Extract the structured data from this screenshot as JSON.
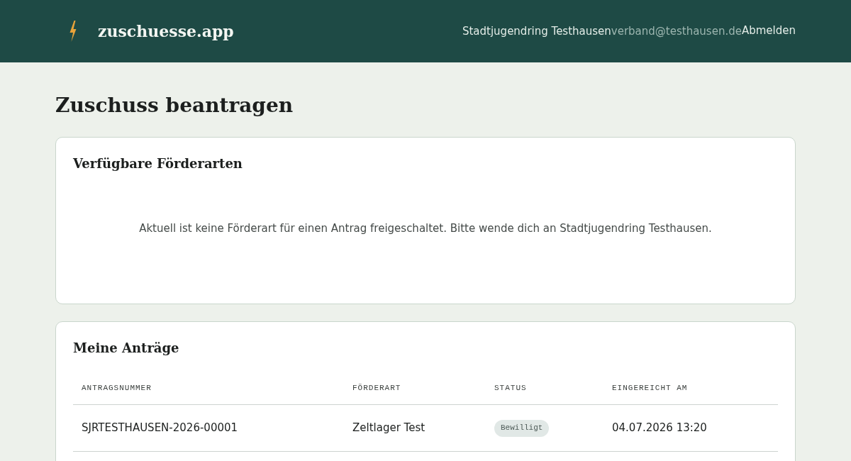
{
  "header": {
    "brand": "zuschuesse.app",
    "organization": "Stadtjugendring Testhausen",
    "email": "verband@testhausen.de",
    "logout": "Abmelden"
  },
  "page_title": "Zuschuss beantragen",
  "funding_types": {
    "title": "Verfügbare Förderarten",
    "empty_message": "Aktuell ist keine Förderart für einen Antrag freigeschaltet. Bitte wende dich an Stadtjugendring Testhausen."
  },
  "applications": {
    "title": "Meine Anträge",
    "table": {
      "columns": [
        "ANTRAGSNUMMER",
        "FÖRDERART",
        "STATUS",
        "EINGEREICHT AM"
      ],
      "rows": [
        {
          "number": "SJRTESTHAUSEN-2026-00001",
          "funding_type": "Zeltlager Test",
          "status": "Bewilligt",
          "submitted": "04.07.2026 13:20"
        }
      ]
    }
  }
}
